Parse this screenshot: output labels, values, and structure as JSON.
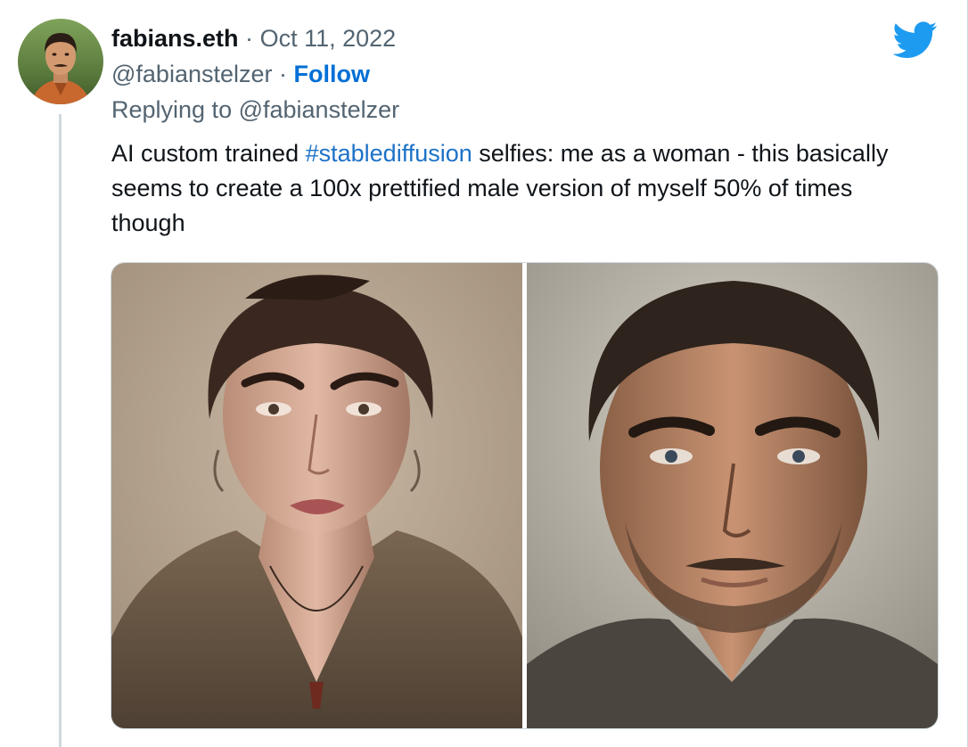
{
  "tweet": {
    "display_name": "fabians.eth",
    "separator": "·",
    "date": "Oct 11, 2022",
    "handle": "@fabianstelzer",
    "follow_label": "Follow",
    "reply_prefix": "Replying to ",
    "reply_to": "@fabianstelzer",
    "text_before": "AI custom trained ",
    "hashtag": "#stablediffusion",
    "text_after": " selfies: me as a woman - this basically seems to create a 100x prettified male version of myself 50% of times though"
  },
  "icons": {
    "brand": "twitter-bird-icon",
    "brand_color": "#1d9bf0"
  },
  "media": {
    "images": [
      {
        "subject": "woman-portrait"
      },
      {
        "subject": "man-portrait"
      }
    ]
  },
  "colors": {
    "link": "#1d72c7",
    "muted": "#536471",
    "border": "#cfd9de"
  }
}
